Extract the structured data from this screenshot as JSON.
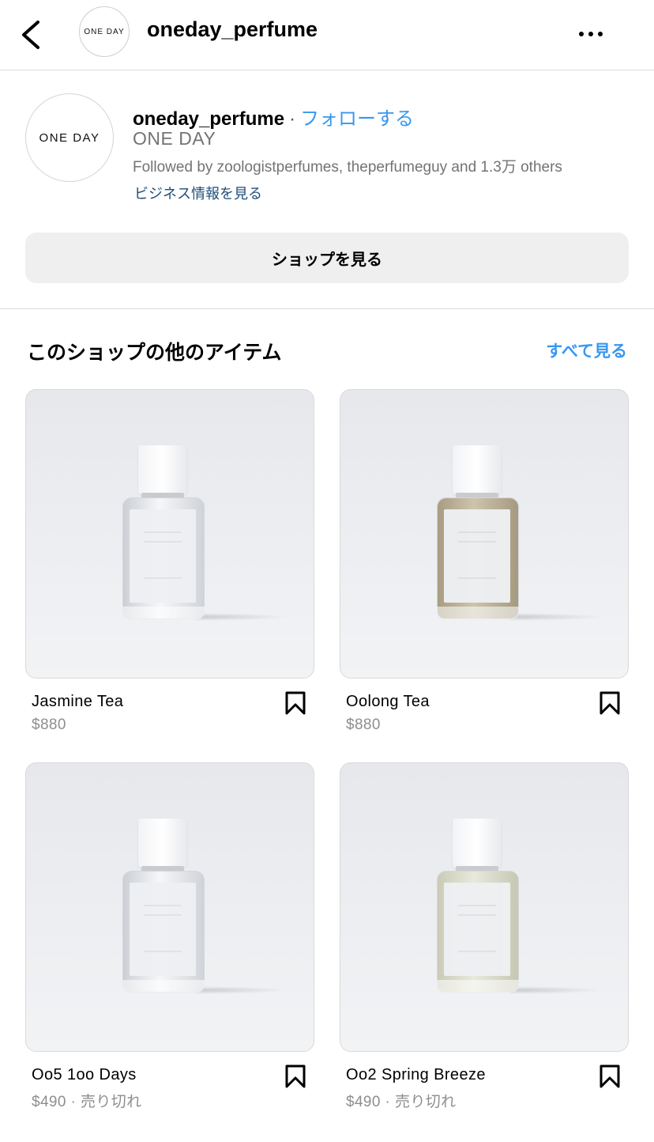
{
  "header": {
    "title": "oneday_perfume",
    "avatar_text": "ONE DAY",
    "back_icon": "chevron-left-icon",
    "more_icon": "more-horizontal-icon"
  },
  "profile": {
    "avatar_text": "ONE DAY",
    "username": "oneday_perfume",
    "separator": "·",
    "follow_label": "フォローする",
    "display_name": "ONE DAY",
    "followed_by": "Followed by zoologistperfumes, theperfumeguy and 1.3万 others",
    "business_info_link": "ビジネス情報を見る"
  },
  "shop_button": {
    "label": "ショップを見る"
  },
  "section": {
    "title": "このショップの他のアイテム",
    "see_all_label": "すべて見る"
  },
  "products": [
    {
      "name": "Jasmine Tea",
      "price": "$880"
    },
    {
      "name": "Oolong Tea",
      "price": "$880"
    },
    {
      "name": "Oo5 1oo Days",
      "price": "$490 · 売り切れ"
    },
    {
      "name": "Oo2 Spring Breeze",
      "price": "$490 · 売り切れ"
    }
  ],
  "colors": {
    "link_blue": "#3897f0",
    "business_link": "#1f4e79",
    "secondary_text": "#737373",
    "button_bg": "#efefef"
  }
}
